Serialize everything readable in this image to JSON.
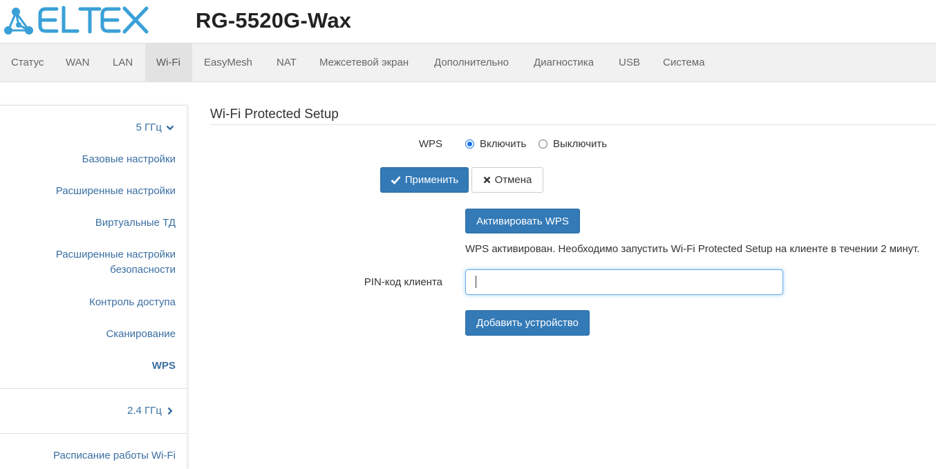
{
  "header": {
    "model": "RG-5520G-Wax",
    "logo_text": "ELTEX",
    "brand_color": "#3aa0d8"
  },
  "nav": {
    "items": [
      {
        "label": "Статус"
      },
      {
        "label": "WAN"
      },
      {
        "label": "LAN"
      },
      {
        "label": "Wi-Fi",
        "active": true
      },
      {
        "label": "EasyMesh"
      },
      {
        "label": "NAT"
      },
      {
        "label": "Межсетевой экран"
      },
      {
        "label": "Дополнительно"
      },
      {
        "label": "Диагностика"
      },
      {
        "label": "USB"
      },
      {
        "label": "Система"
      }
    ]
  },
  "sidebar": {
    "band5": {
      "label": "5 ГГц",
      "icon": "chevron-down-icon"
    },
    "items": [
      {
        "label": "Базовые настройки"
      },
      {
        "label": "Расширенные настройки"
      },
      {
        "label": "Виртуальные ТД"
      },
      {
        "label_line1": "Расширенные настройки",
        "label_line2": "безопасности"
      },
      {
        "label": "Контроль доступа"
      },
      {
        "label": "Сканирование"
      },
      {
        "label": "WPS",
        "active": true
      }
    ],
    "band24": {
      "label": "2.4 ГГц",
      "icon": "chevron-right-icon"
    },
    "schedule": {
      "label": "Расписание работы Wi-Fi"
    }
  },
  "content": {
    "title": "Wi-Fi Protected Setup",
    "wps": {
      "label": "WPS",
      "enable_label": "Включить",
      "disable_label": "Выключить",
      "selected": "enable"
    },
    "apply_label": "Применить",
    "cancel_label": "Отмена",
    "activate_label": "Активировать WPS",
    "info_text": "WPS активирован. Необходимо запустить Wi-Fi Protected Setup на клиенте в течении 2 минут.",
    "pin": {
      "label": "PIN-код клиента",
      "value": "",
      "placeholder": ""
    },
    "add_device_label": "Добавить устройство"
  },
  "colors": {
    "primary": "#337ab7",
    "link": "#3a6fa3",
    "nav_bg": "#f1f1f1",
    "nav_active_bg": "#e2e2e2"
  }
}
